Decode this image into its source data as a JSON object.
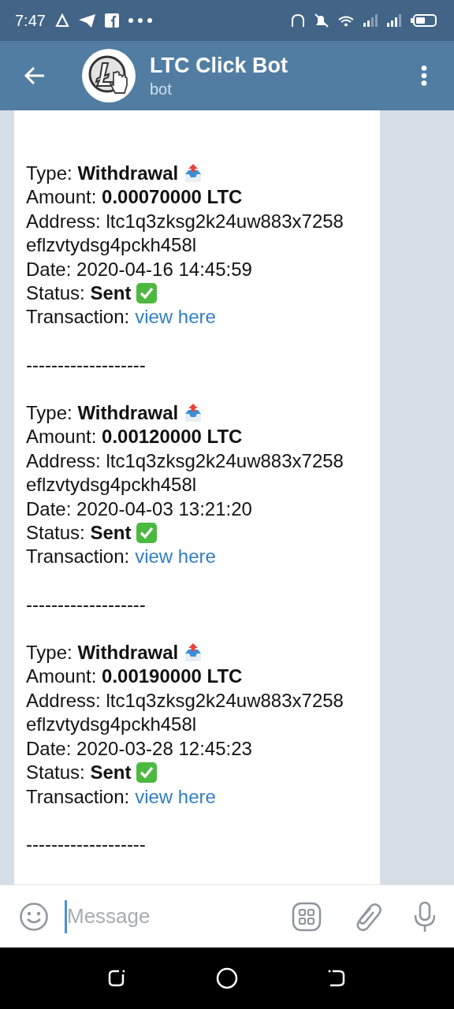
{
  "status_bar": {
    "time": "7:47"
  },
  "header": {
    "title": "LTC Click Bot",
    "subtitle": "bot"
  },
  "transactions": [
    {
      "type": "Type: **Withdrawal**",
      "amount": "Amount: **0.00070000 LTC**",
      "address": "Address: ltc1q3zksg2k24uw883x7258eflzvtydsg4pckh458l",
      "date": "Date: 2020-04-16 14:45:59",
      "status": "Status: **Sent**",
      "transaction_label": "Transaction:",
      "link": "view here",
      "separator": "-------------------"
    },
    {
      "type": "Type: **Withdrawal**",
      "amount": "Amount: **0.00120000 LTC**",
      "address": "Address: ltc1q3zksg2k24uw883x7258eflzvtydsg4pckh458l",
      "date": "Date: 2020-04-03 13:21:20",
      "status": "Status: **Sent**",
      "transaction_label": "Transaction:",
      "link": "view here",
      "separator": "-------------------"
    },
    {
      "type": "Type: **Withdrawal**",
      "amount": "Amount: **0.00190000 LTC**",
      "address": "Address: ltc1q3zksg2k24uw883x7258eflzvtydsg4pckh458l",
      "date": "Date: 2020-03-28 12:45:23",
      "status": "Status: **Sent**",
      "transaction_label": "Transaction:",
      "link": "view here",
      "separator": "-------------------"
    }
  ],
  "composer": {
    "placeholder": "Message"
  }
}
